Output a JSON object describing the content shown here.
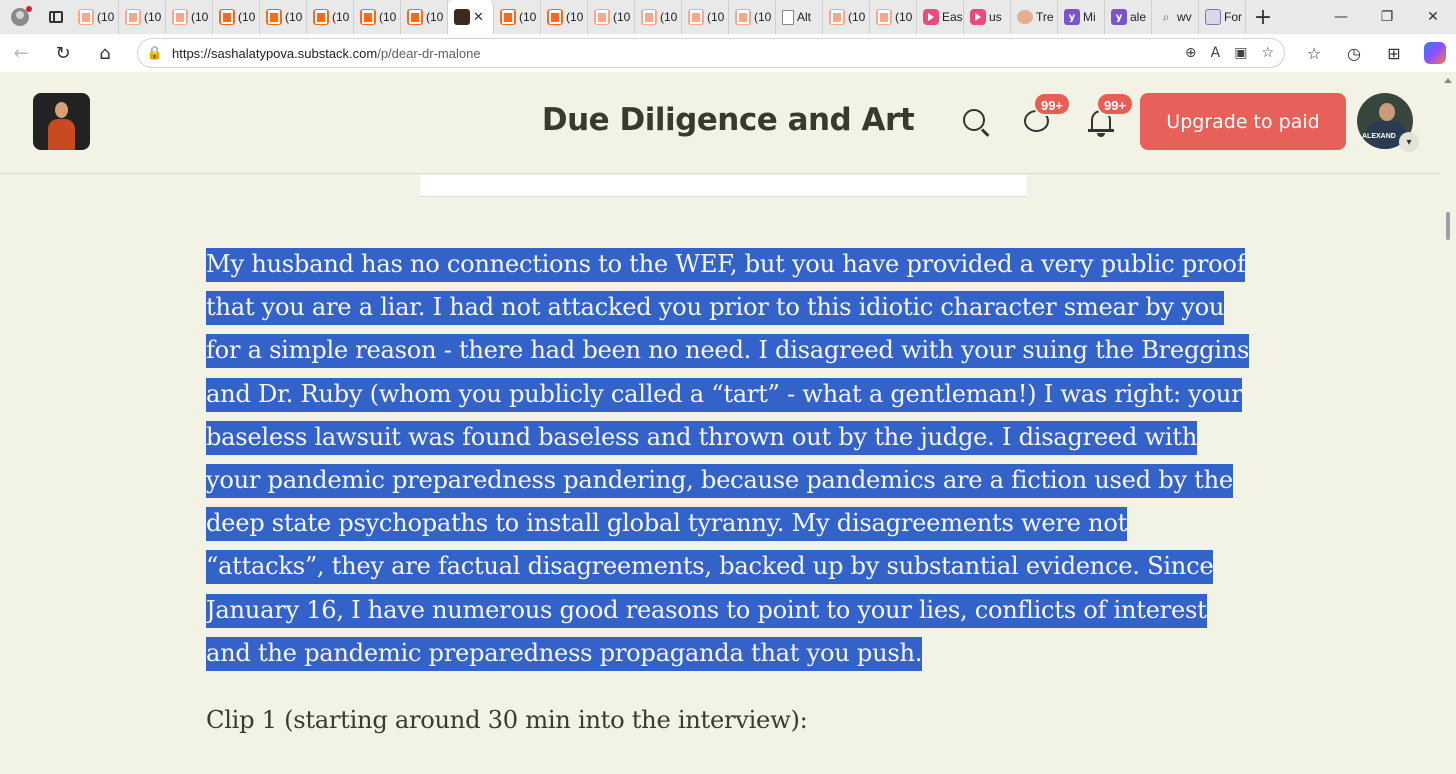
{
  "browser": {
    "tabs": [
      {
        "label": "(10",
        "icon": "substack-icon"
      },
      {
        "label": "(10",
        "icon": "substack-icon"
      },
      {
        "label": "(10",
        "icon": "substack-icon"
      },
      {
        "label": "(10",
        "icon": "substack-icon"
      },
      {
        "label": "(10",
        "icon": "substack-icon"
      },
      {
        "label": "(10",
        "icon": "substack-icon"
      },
      {
        "label": "(10",
        "icon": "substack-icon"
      },
      {
        "label": "(10",
        "icon": "substack-icon"
      },
      {
        "label": "",
        "icon": "profile-photo-icon",
        "active": true
      },
      {
        "label": "(10",
        "icon": "substack-icon"
      },
      {
        "label": "(10",
        "icon": "substack-icon"
      },
      {
        "label": "(10",
        "icon": "substack-icon"
      },
      {
        "label": "(10",
        "icon": "substack-icon"
      },
      {
        "label": "(10",
        "icon": "substack-icon"
      },
      {
        "label": "(10",
        "icon": "substack-icon"
      },
      {
        "label": "Alt",
        "icon": "document-icon"
      },
      {
        "label": "(10",
        "icon": "substack-icon"
      },
      {
        "label": "(10",
        "icon": "substack-icon"
      },
      {
        "label": "Eas",
        "icon": "youtube-icon"
      },
      {
        "label": "us",
        "icon": "youtube-icon"
      },
      {
        "label": "Tre",
        "icon": "circle-icon"
      },
      {
        "label": "Mi",
        "icon": "yahoo-icon"
      },
      {
        "label": "ale",
        "icon": "yahoo-icon"
      },
      {
        "label": "wv",
        "icon": "search-icon"
      },
      {
        "label": "For",
        "icon": "news-icon"
      }
    ],
    "close_glyph": "✕",
    "new_tab_glyph": "+",
    "window_controls": {
      "minimize": "—",
      "maximize": "❐",
      "close": "✕"
    },
    "address": {
      "host": "https://sashalatypova.substack.com",
      "path": "/p/dear-dr-malone"
    },
    "nav": {
      "back": "←",
      "reload": "↻",
      "home": "⌂"
    },
    "omnibox_icons": {
      "zoom": "⊕",
      "read_aloud": "A",
      "immersive": "▣",
      "favorite": "☆"
    },
    "toolbar_icons": {
      "favorites": "☆",
      "history": "◷",
      "extensions": "⊞"
    }
  },
  "site": {
    "title": "Due Diligence and Art",
    "chat_badge": "99+",
    "notification_badge": "99+",
    "upgrade_label": "Upgrade to paid",
    "avatar_tag": "ALEXAND",
    "avatar_caret": "▾"
  },
  "article": {
    "selected_paragraph": "My husband has no connections to the WEF, but you have provided a very public proof that you are a liar. I had not attacked you prior to this idiotic character smear by you for a simple reason - there had been no need. I disagreed with your suing the Breggins and Dr. Ruby (whom you publicly called a “tart” - what a gentleman!) I was right: your baseless lawsuit was found baseless and thrown out by the judge. I disagreed with your pandemic preparedness pandering, because pandemics are a fiction used by the deep state psychopaths to install global tyranny. My disagreements were not “attacks”, they are factual disagreements, backed up by substantial evidence. Since January 16, I have numerous good reasons to point to your lies, conflicts of interest and the pandemic preparedness propaganda that you push.",
    "clip_heading": "Clip 1 (starting around 30 min into the interview):"
  },
  "colors": {
    "page_bg": "#f2f2e5",
    "selection": "#3363c9",
    "upgrade_button": "#e8605a",
    "badge": "#e85d54"
  }
}
